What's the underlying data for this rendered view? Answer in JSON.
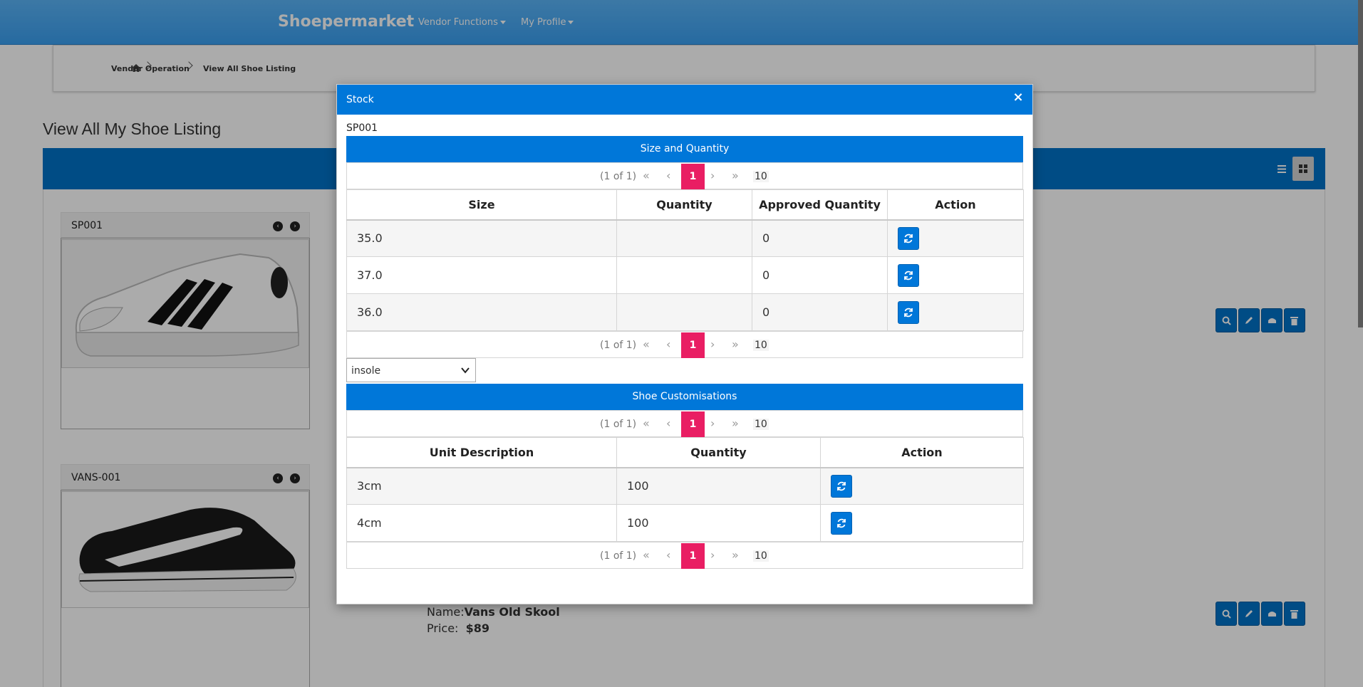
{
  "app": {
    "brand": "Shoepermarket",
    "menus": [
      {
        "label": "Vendor Functions"
      },
      {
        "label": "My Profile"
      }
    ]
  },
  "breadcrumb": {
    "items": [
      "Vendor Operation",
      "View All Shoe Listing"
    ]
  },
  "page": {
    "title": "View All My Shoe Listing"
  },
  "listings": [
    {
      "code": "SP001",
      "name_label": "",
      "name": "",
      "price_label": "",
      "price": ""
    },
    {
      "code": "VANS-001",
      "name_label": "Name:",
      "name": "Vans Old Skool",
      "price_label": "Price:",
      "price": "$89"
    }
  ],
  "colors": {
    "topbar": "#3a9ff0",
    "primary": "#0077d9",
    "page_highlight": "#e91e63"
  },
  "modal": {
    "title": "Stock",
    "close_icon": "×",
    "product_code": "SP001",
    "size_table": {
      "header": "Size and Quantity",
      "paginator": {
        "current": "(1 of 1)",
        "page": "1",
        "rows": "10"
      },
      "columns": [
        "Size",
        "Quantity",
        "Approved Quantity",
        "Action"
      ],
      "rows": [
        {
          "size": "35.0",
          "quantity": "",
          "approved": "0"
        },
        {
          "size": "37.0",
          "quantity": "",
          "approved": "0"
        },
        {
          "size": "36.0",
          "quantity": "",
          "approved": "0"
        }
      ]
    },
    "customisation_select": {
      "value": "insole"
    },
    "custom_table": {
      "header": "Shoe Customisations",
      "paginator": {
        "current": "(1 of 1)",
        "page": "1",
        "rows": "10"
      },
      "columns": [
        "Unit Description",
        "Quantity",
        "Action"
      ],
      "rows": [
        {
          "unit": "3cm",
          "quantity": "100"
        },
        {
          "unit": "4cm",
          "quantity": "100"
        }
      ]
    }
  }
}
